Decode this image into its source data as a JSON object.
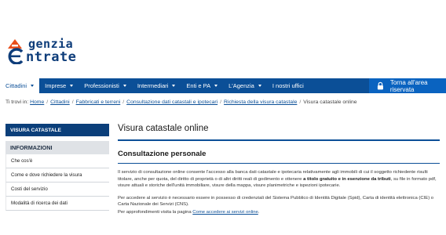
{
  "logo": {
    "line1": "genzia",
    "line2": "ntrate",
    "brand_color": "#0e3d7a",
    "accent": "#e94e1b"
  },
  "nav": {
    "items": [
      {
        "label": "Cittadini",
        "has_caret": true,
        "active": true
      },
      {
        "label": "Imprese",
        "has_caret": true
      },
      {
        "label": "Professionisti",
        "has_caret": true
      },
      {
        "label": "Intermediari",
        "has_caret": true
      },
      {
        "label": "Enti e PA",
        "has_caret": true
      },
      {
        "label": "L'Agenzia",
        "has_caret": true
      },
      {
        "label": "I nostri uffici",
        "has_caret": false
      }
    ],
    "reserved_label": "Torna all'area riservata",
    "bar_color": "#0b4f97",
    "reserved_color": "#0a63c0"
  },
  "breadcrumb": {
    "prefix": "Ti trovi in:",
    "links": [
      "Home",
      "Cittadini",
      "Fabbricati e terreni",
      "Consultazione dati catastali e ipotecari",
      "Richiesta della visura catastale"
    ],
    "current": "Visura catastale online"
  },
  "sidebar": {
    "title": "VISURA CATASTALE",
    "section": "INFORMAZIONI",
    "items": [
      "Che cos'è",
      "Come e dove richiedere la visura",
      "Costi del servizio",
      "Modalità di ricerca dei dati"
    ]
  },
  "main": {
    "title": "Visura catastale online",
    "section_title": "Consultazione personale",
    "p1_a": "Il servizio di consultazione online consente l'accesso alla banca dati catastale e ipotecaria relativamente agli immobili di cui il soggetto richiedente risulti titolare, anche per quota, del diritto di proprietà o di altri diritti reali di godimento e ottenere ",
    "p1_bold": "a titolo gratuito e in esenzione da tributi",
    "p1_b": ", su file in formato pdf, visure attuali e storiche dell'unità immobiliare, visure della mappa, visure planimetriche e ispezioni ipotecarie.",
    "p2": "Per accedere al servizio è necessario essere in possesso di credenziali del Sistema Pubblico di Identità Digitale (Spid), Carta di identità elettronica (CIE) o Carta Nazionale dei Servizi (CNS).",
    "p3_prefix": "Per approfondimenti visita la pagina ",
    "p3_link": "Come accedere ai servizi online",
    "p3_suffix": "."
  }
}
